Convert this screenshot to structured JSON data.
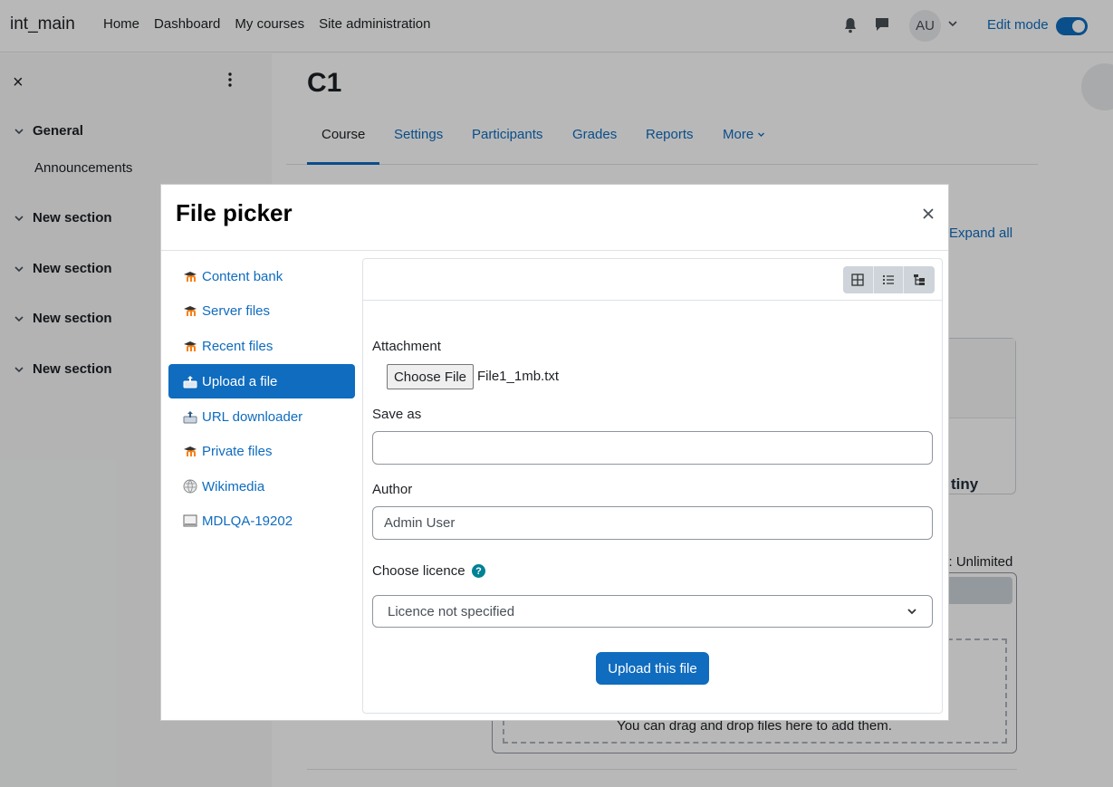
{
  "navbar": {
    "brand": "int_main",
    "links": [
      "Home",
      "Dashboard",
      "My courses",
      "Site administration"
    ],
    "avatar_initials": "AU",
    "edit_mode_label": "Edit mode"
  },
  "drawer": {
    "close_glyph": "×",
    "sections": [
      {
        "label": "General"
      },
      {
        "label": "New section"
      },
      {
        "label": "New section"
      },
      {
        "label": "New section"
      },
      {
        "label": "New section"
      }
    ],
    "subitems": [
      "Announcements"
    ]
  },
  "course": {
    "title": "C1",
    "tabs": [
      "Course",
      "Settings",
      "Participants",
      "Grades",
      "Reports",
      "More"
    ],
    "expand_all": "Expand all",
    "max_files_text": "s: Unlimited",
    "drop_text": "You can drag and drop files here to add them.",
    "tiny_label": "tiny"
  },
  "modal": {
    "title": "File picker",
    "repositories": [
      {
        "label": "Content bank",
        "icon": "moodle-icon"
      },
      {
        "label": "Server files",
        "icon": "moodle-icon"
      },
      {
        "label": "Recent files",
        "icon": "moodle-icon"
      },
      {
        "label": "Upload a file",
        "icon": "upload-icon",
        "active": true
      },
      {
        "label": "URL downloader",
        "icon": "url-icon"
      },
      {
        "label": "Private files",
        "icon": "moodle-icon"
      },
      {
        "label": "Wikimedia",
        "icon": "globe-icon"
      },
      {
        "label": "MDLQA-19202",
        "icon": "folder-icon"
      }
    ],
    "form": {
      "attachment_label": "Attachment",
      "choose_file_label": "Choose File",
      "file_name": "File1_1mb.txt",
      "save_as_label": "Save as",
      "save_as_value": "",
      "author_label": "Author",
      "author_value": "Admin User",
      "licence_label": "Choose licence",
      "help_glyph": "?",
      "licence_value": "Licence not specified",
      "upload_button": "Upload this file"
    }
  },
  "colors": {
    "primary": "#0f6cbf",
    "help": "#008196",
    "moodle_orange": "#f98012"
  }
}
